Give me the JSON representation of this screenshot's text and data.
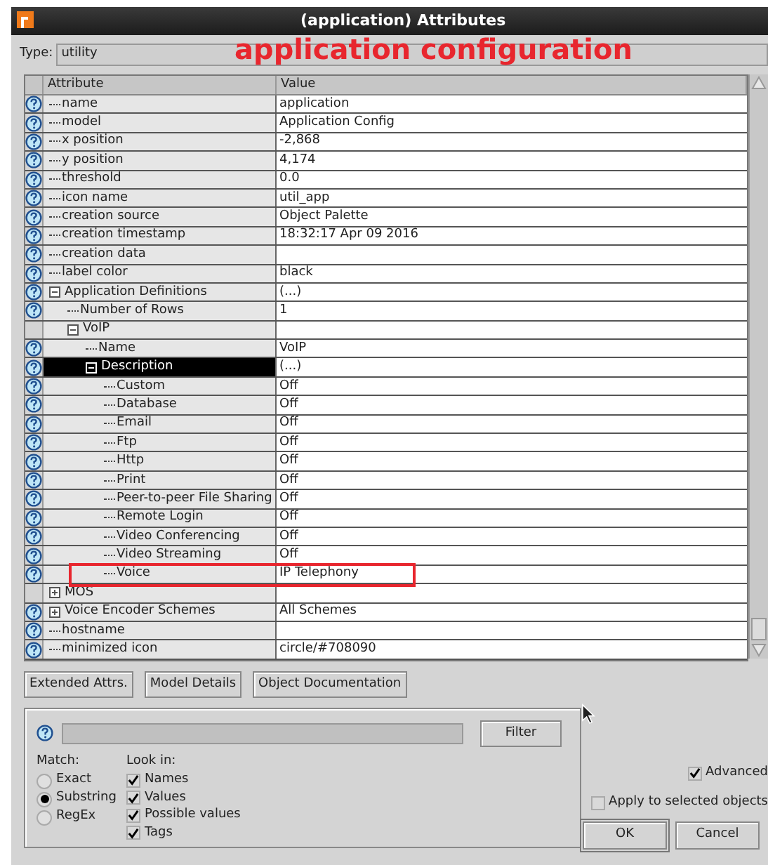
{
  "window": {
    "title": "(application) Attributes"
  },
  "annotation": {
    "text": "application configuration",
    "highlight_box": true
  },
  "type": {
    "label": "Type:",
    "value": "utility"
  },
  "table": {
    "columns": [
      "Attribute",
      "Value"
    ],
    "rows": [
      {
        "name": "name",
        "value": "application",
        "help": true,
        "selected": false
      },
      {
        "name": "model",
        "value": "Application Config",
        "help": true,
        "selected": false
      },
      {
        "name": "x position",
        "value": "-2,868",
        "help": true,
        "selected": false
      },
      {
        "name": "y position",
        "value": "4,174",
        "help": true,
        "selected": false
      },
      {
        "name": "threshold",
        "value": "0.0",
        "help": true,
        "selected": false
      },
      {
        "name": "icon name",
        "value": "util_app",
        "help": true,
        "selected": false
      },
      {
        "name": "creation source",
        "value": "Object Palette",
        "help": true,
        "selected": false
      },
      {
        "name": "creation timestamp",
        "value": "18:32:17 Apr 09 2016",
        "help": true,
        "selected": false
      },
      {
        "name": "creation data",
        "help": true,
        "selected": false
      },
      {
        "name": "label color",
        "value": "black",
        "help": true,
        "selected": false
      },
      {
        "name": "Application Definitions",
        "value": "(...)",
        "help": true,
        "selected": false,
        "expanded": true,
        "children": [
          {
            "name": "Number of Rows",
            "value": "1",
            "help": true,
            "selected": false
          },
          {
            "name": "VoIP",
            "help": false,
            "selected": false,
            "expanded": true,
            "children": [
              {
                "name": "Name",
                "value": "VoIP",
                "help": true,
                "selected": false
              },
              {
                "name": "Description",
                "value": "(...)",
                "help": true,
                "selected": true,
                "expanded": true,
                "children": [
                  {
                    "name": "Custom",
                    "value": "Off",
                    "help": true,
                    "selected": false
                  },
                  {
                    "name": "Database",
                    "value": "Off",
                    "help": true,
                    "selected": false
                  },
                  {
                    "name": "Email",
                    "value": "Off",
                    "help": true,
                    "selected": false
                  },
                  {
                    "name": "Ftp",
                    "value": "Off",
                    "help": true,
                    "selected": false
                  },
                  {
                    "name": "Http",
                    "value": "Off",
                    "help": true,
                    "selected": false
                  },
                  {
                    "name": "Print",
                    "value": "Off",
                    "help": true,
                    "selected": false
                  },
                  {
                    "name": "Peer-to-peer File Sharing",
                    "value": "Off",
                    "help": true,
                    "selected": false
                  },
                  {
                    "name": "Remote Login",
                    "value": "Off",
                    "help": true,
                    "selected": false
                  },
                  {
                    "name": "Video Conferencing",
                    "value": "Off",
                    "help": true,
                    "selected": false
                  },
                  {
                    "name": "Video Streaming",
                    "value": "Off",
                    "help": true,
                    "selected": false
                  },
                  {
                    "name": "Voice",
                    "value": "IP Telephony",
                    "help": true,
                    "selected": false
                  }
                ]
              }
            ]
          }
        ]
      },
      {
        "name": "MOS",
        "help": false,
        "selected": false,
        "expanded": false
      },
      {
        "name": "Voice Encoder Schemes",
        "value": "All Schemes",
        "help": true,
        "selected": false,
        "expanded": false
      },
      {
        "name": "hostname",
        "help": true,
        "selected": false
      },
      {
        "name": "minimized icon",
        "value": "circle/#708090",
        "help": true,
        "selected": false
      }
    ]
  },
  "buttons": [
    "Extended Attrs.",
    "Model Details",
    "Object Documentation"
  ],
  "filter": {
    "button": "Filter",
    "match_label": "Match:",
    "match_options": [
      {
        "label": "Exact",
        "selected": false
      },
      {
        "label": "Substring",
        "selected": true
      },
      {
        "label": "RegEx",
        "selected": false
      }
    ],
    "look_in_label": "Look in:",
    "look_in": [
      {
        "label": "Names",
        "checked": true
      },
      {
        "label": "Values",
        "checked": true
      },
      {
        "label": "Possible values",
        "checked": true
      },
      {
        "label": "Tags",
        "checked": true
      }
    ]
  },
  "advanced": {
    "label": "Advanced",
    "checked": true
  },
  "apply": {
    "label": "Apply to selected objects",
    "checked": false
  },
  "dialog_buttons": [
    "OK",
    "Cancel"
  ]
}
